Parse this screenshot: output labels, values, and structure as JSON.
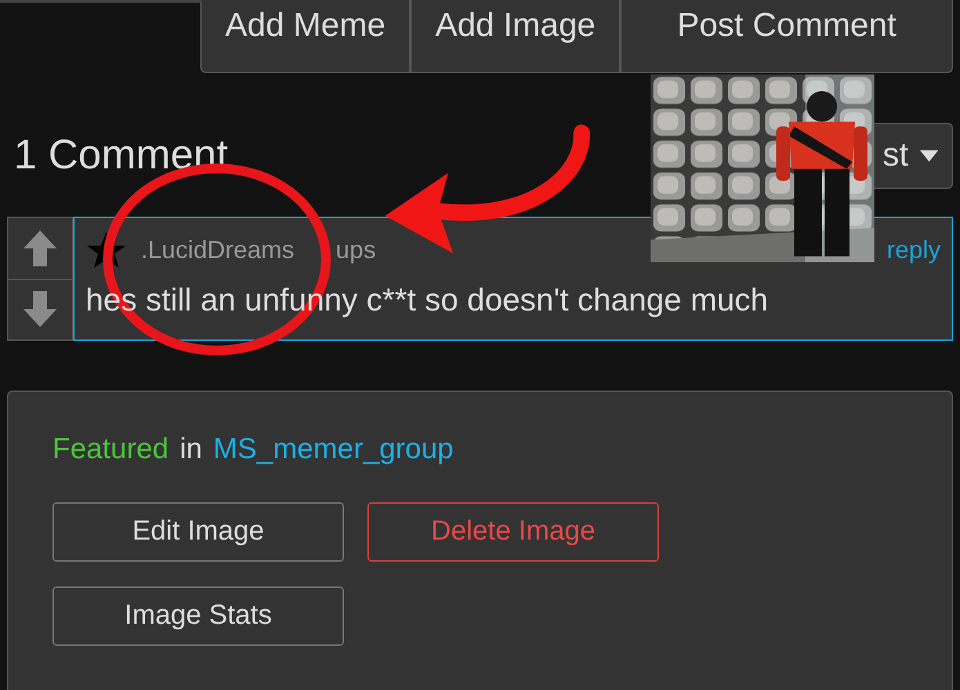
{
  "toolbar": {
    "buttons": [
      "Add Meme",
      "Add Image",
      "Post Comment"
    ]
  },
  "comments_header": {
    "title": "1 Comment",
    "sort_label": "st"
  },
  "comment": {
    "username": ".LucidDreams",
    "mention": "ups",
    "text": "hes still an unfunny c**t so doesn't change much",
    "reply": "reply"
  },
  "featured": {
    "label": "Featured",
    "joiner": "in",
    "group": "MS_memer_group"
  },
  "actions": [
    {
      "label": "Edit Image",
      "kind": "normal"
    },
    {
      "label": "Delete Image",
      "kind": "danger"
    },
    {
      "label": "Image Stats",
      "kind": "normal"
    }
  ]
}
